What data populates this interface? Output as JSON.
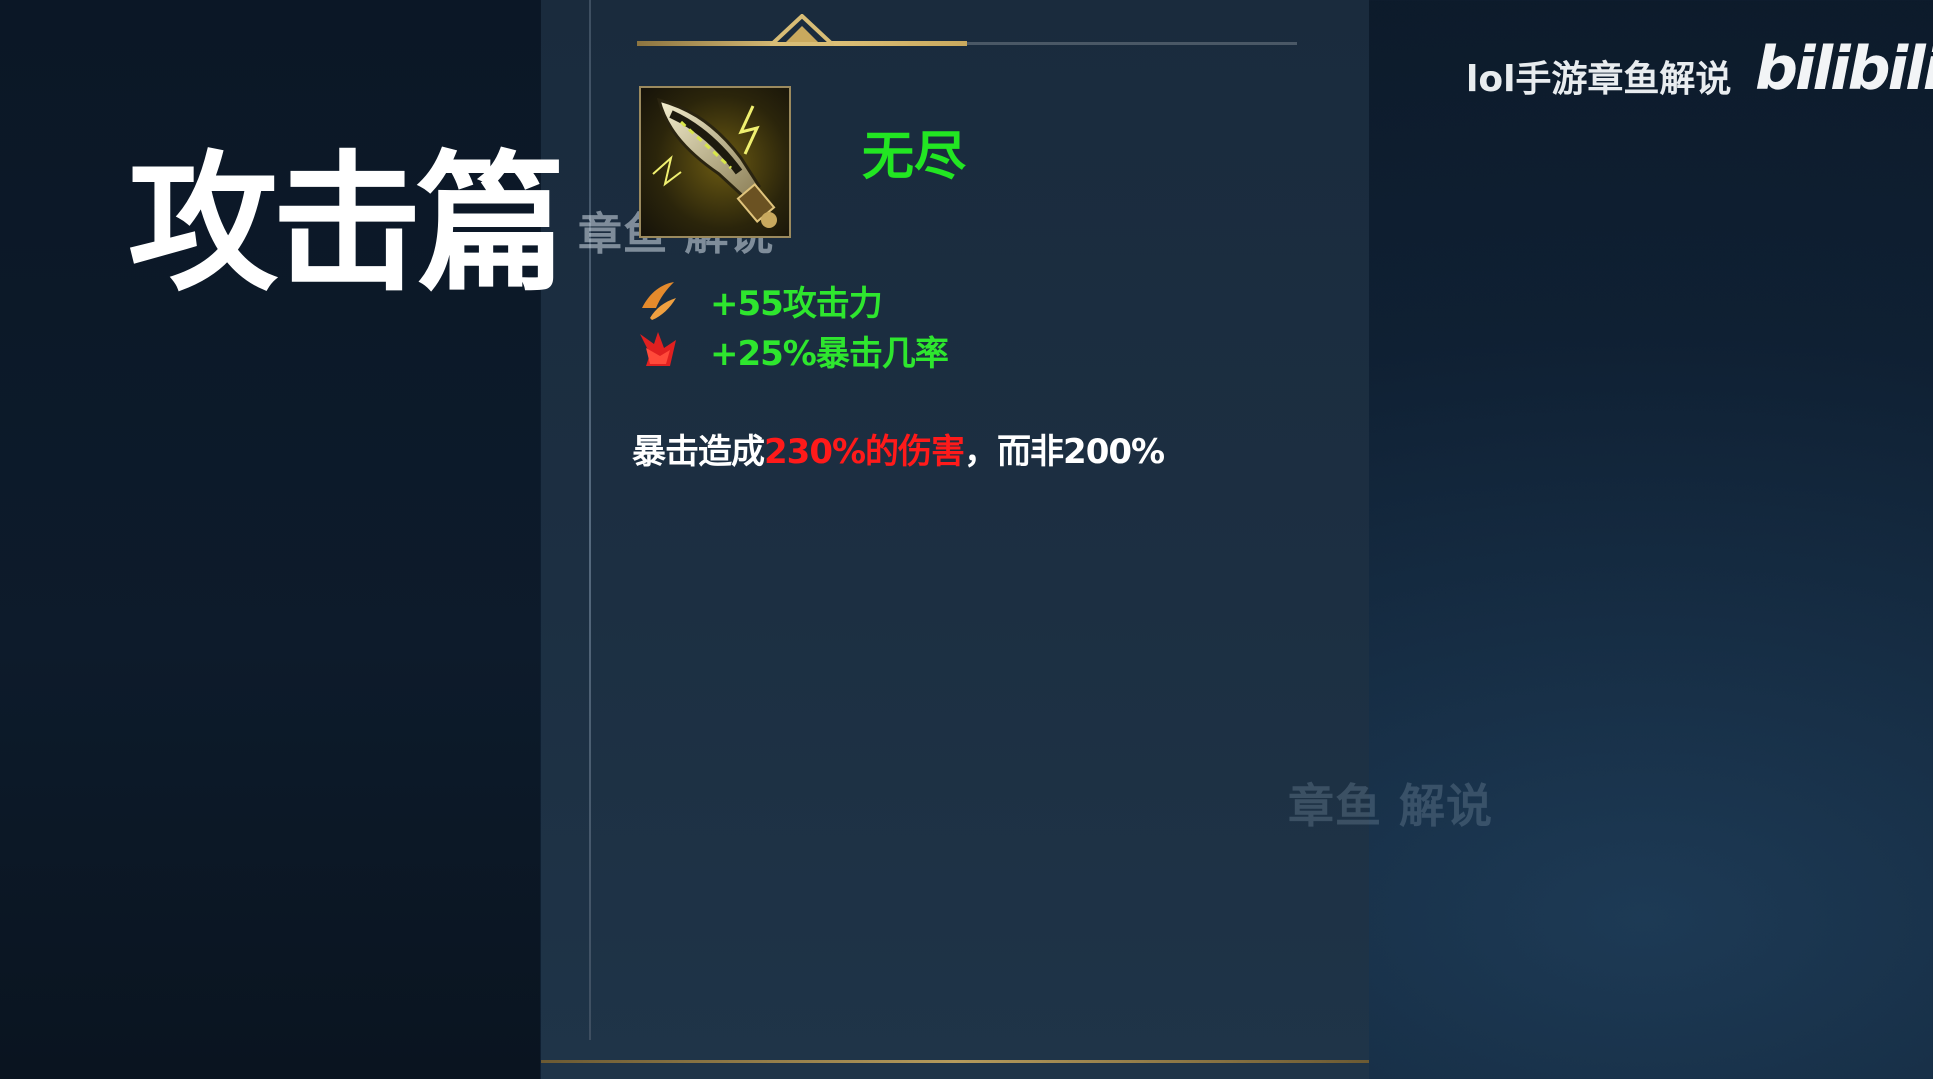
{
  "overlay": {
    "title": "攻击篇",
    "watermark": "章鱼 解说",
    "channel": "lol手游章鱼解说",
    "platform_logo": "bilibili"
  },
  "item": {
    "name": "无尽",
    "icon": "sword-icon",
    "stats": [
      {
        "icon": "attack-damage-icon",
        "text": "+55攻击力"
      },
      {
        "icon": "crit-chance-icon",
        "text": "+25%暴击几率"
      }
    ],
    "description": {
      "prefix": "暴击造成",
      "highlight": "230%的伤害",
      "suffix": "，而非200%"
    }
  },
  "colors": {
    "stat_green": "#2ee62e",
    "name_green": "#22e622",
    "highlight_red": "#ff1a1a",
    "accent_gold": "#e0c47c"
  }
}
